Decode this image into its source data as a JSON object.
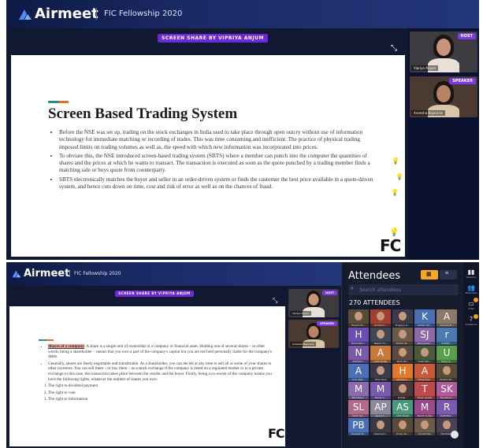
{
  "brand": "Airmeet",
  "event_title": "FIC Fellowship 2020",
  "screen_share_banner": "SCREEN SHARE BY VIPRIYA ANJUM",
  "colors": {
    "accent": "#7c3aed",
    "teal": "#2c8a8a",
    "orange": "#e3701e",
    "header": "#1a2a66"
  },
  "top": {
    "slide": {
      "title": "Screen Based Trading System",
      "bullets": [
        "Before the NSE was set up, trading on the stock exchanges in India used to take place through open outcry without use of information technology for immediate matching or recording of trades. This was time consuming and inefficient. The practice of physical trading imposed limits on trading volumes as well as, the speed with which new information was incorporated into prices.",
        "To obviate this, the NSE introduced screen-based trading system (SBTS) where a member can punch into the computer the quantities of shares and the prices at which he wants to transact. The transaction is executed as soon as the quote punched by a trading member finds a matching sale or buys quote from counterparty.",
        "SBTS electronically matches the buyer and seller in an order-driven system or finds the customer the best price available in a quote-driven system, and hence cuts down on time, cost and risk of error as well as on the chances of fraud."
      ],
      "logo_text": "FC"
    },
    "host": {
      "role": "HOST",
      "name": "Vipriya Anjum"
    },
    "speaker": {
      "role": "SPEAKER",
      "name": "Aneesha Bajoraria"
    }
  },
  "bottom": {
    "slide": {
      "bullet1_highlight": "Shares of a company",
      "bullet1_rest": ": A share is a single unit of ownership in a company or financial asset. Holding one of several shares – in other words, being a shareholder – means that you own a part of the company's capital but you are not held personally liable for the company's debts.",
      "bullet2": "Generally, shares are freely negotiable and transferable. As a shareholder, you can decide at any time to sell all or some of your shares to other investors. You can sell them – or buy them – as a stock exchange if the company is listed on a regulated market or in a private exchange in this case, the transaction takes place between the vendor and the buyer. Firstly, being a co-owner of the company means you have the following rights, whatever the number of shares you own:",
      "rights": [
        "The right to dividend payment",
        "The right to vote",
        "The right to information"
      ],
      "logo_text": "FC"
    },
    "host": {
      "role": "HOST",
      "name": "Vipriya Anjum"
    },
    "speaker": {
      "role": "SPEAKER",
      "name": "Aneesha Bajoraria"
    },
    "attendees": {
      "title": "Attendees",
      "search_placeholder": "Search attendees",
      "count_label": "270 ATTENDEES",
      "avatars": [
        {
          "letter": "",
          "caption": "Harshil Sh...",
          "color": "#5a4a3a"
        },
        {
          "letter": "",
          "caption": "Kumkum...",
          "color": "#a04030"
        },
        {
          "letter": "",
          "caption": "Pragnya G...",
          "color": "#3a3a4a"
        },
        {
          "letter": "K",
          "caption": "Kishan Ch...",
          "color": "#4a6fb5"
        },
        {
          "letter": "A",
          "caption": "Ananya N...",
          "color": "#8a7a6a"
        },
        {
          "letter": "H",
          "caption": "Himanshu...",
          "color": "#6a4fb0"
        },
        {
          "letter": "",
          "caption": "Tejash Ch...",
          "color": "#404858"
        },
        {
          "letter": "",
          "caption": "Prachi Ya...",
          "color": "#6a5a4a"
        },
        {
          "letter": "SJ",
          "caption": "Shreyansh...",
          "color": "#8a6aa8"
        },
        {
          "letter": "r",
          "caption": "rishabh...",
          "color": "#4a7ab0"
        },
        {
          "letter": "N",
          "caption": "Nimisha...",
          "color": "#7a5aa8"
        },
        {
          "letter": "A",
          "caption": "Aditi Singh",
          "color": "#c87a3a"
        },
        {
          "letter": "",
          "caption": "Tanvi Kh...",
          "color": "#5a4a40"
        },
        {
          "letter": "",
          "caption": "Ansh Pan...",
          "color": "#4a5a3a"
        },
        {
          "letter": "U",
          "caption": "Uday G...",
          "color": "#5aa04a"
        },
        {
          "letter": "A",
          "caption": "Arun Kap...",
          "color": "#4a6fb5"
        },
        {
          "letter": "",
          "caption": "Tanvi Ryal",
          "color": "#3a3a48"
        },
        {
          "letter": "H",
          "caption": "Harshil A...",
          "color": "#e07a2a"
        },
        {
          "letter": "A",
          "caption": "Aditya Rat...",
          "color": "#c85a3a"
        },
        {
          "letter": "",
          "caption": "Vedant Sh...",
          "color": "#5a4a3a"
        },
        {
          "letter": "M",
          "caption": "Mandeep...",
          "color": "#8a6ab0"
        },
        {
          "letter": "M",
          "caption": "Manik G...",
          "color": "#7a5ab0"
        },
        {
          "letter": "",
          "caption": "Kumar...",
          "color": "#4a3a3a"
        },
        {
          "letter": "T",
          "caption": "Tarun Gupta",
          "color": "#c04a4a"
        },
        {
          "letter": "SK",
          "caption": "Shruthi K...",
          "color": "#b05a9a"
        },
        {
          "letter": "SL",
          "caption": "Sristi Lal...",
          "color": "#b06a8a"
        },
        {
          "letter": "AP",
          "caption": "Apoorv...",
          "color": "#8a8a9a"
        },
        {
          "letter": "AS",
          "caption": "Aditi Singh",
          "color": "#4a9a7a"
        },
        {
          "letter": "M",
          "caption": "Manik Gupta",
          "color": "#9a4a8a"
        },
        {
          "letter": "R",
          "caption": "RADHIKA...",
          "color": "#7a5ab0"
        },
        {
          "letter": "PB",
          "caption": "Prakash B...",
          "color": "#4a6fb5"
        },
        {
          "letter": "",
          "caption": "Vaishnavi...",
          "color": "#3a3a44"
        },
        {
          "letter": "",
          "caption": "Shrey Sh...",
          "color": "#5a4a3a"
        },
        {
          "letter": "",
          "caption": "Arnold Dev",
          "color": "#6a5a48"
        },
        {
          "letter": "",
          "caption": "Harshita...",
          "color": "#4a4050"
        }
      ]
    },
    "rail": [
      {
        "icon": "sessions-icon",
        "glyph": "▮▮",
        "label": "Sessions"
      },
      {
        "icon": "attendees-icon",
        "glyph": "👥",
        "label": "Attendees"
      },
      {
        "icon": "chat-icon",
        "glyph": "▭",
        "label": "Chat"
      },
      {
        "icon": "questions-icon",
        "glyph": "?",
        "label": "Questions"
      }
    ]
  }
}
